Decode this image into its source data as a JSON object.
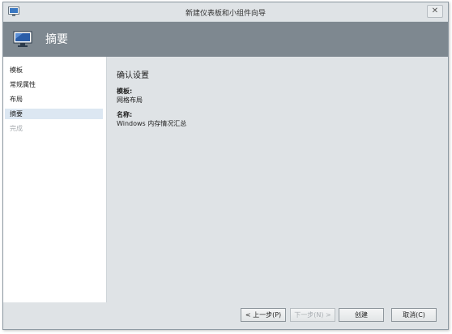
{
  "window": {
    "title": "新建仪表板和小组件向导",
    "close_glyph": "✕"
  },
  "header": {
    "title": "摘要",
    "icon": "monitor-icon"
  },
  "sidebar": {
    "items": [
      {
        "label": "模板",
        "state": "normal"
      },
      {
        "label": "常规属性",
        "state": "normal"
      },
      {
        "label": "布局",
        "state": "normal"
      },
      {
        "label": "摘要",
        "state": "active"
      },
      {
        "label": "完成",
        "state": "disabled"
      }
    ]
  },
  "content": {
    "section_title": "确认设置",
    "fields": [
      {
        "label": "模板:",
        "value": "网格布局"
      },
      {
        "label": "名称:",
        "value": "Windows 内存情况汇总"
      }
    ]
  },
  "footer": {
    "back_label": "< 上一步(P)",
    "next_label": "下一步(N) >",
    "create_label": "创建",
    "cancel_label": "取消(C)"
  },
  "colors": {
    "header_bg": "#7e8890",
    "window_bg": "#dfe3e6",
    "active_nav_bg": "#dce7f2"
  }
}
